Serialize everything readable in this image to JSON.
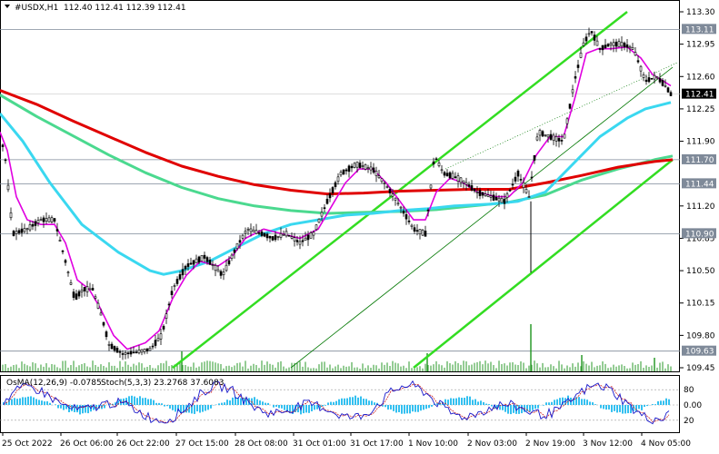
{
  "header": {
    "symbol": "#USDX,H1",
    "ohlc": "112.40 112.41 112.39 112.41"
  },
  "indicator_header": {
    "osma": "OsMA(12,26,9) -0.0785",
    "stoch": "Stoch(5,3,3) 23.2768 37.6083"
  },
  "colors": {
    "background": "#ffffff",
    "candles": "#000000",
    "ma_red": "#e00000",
    "ma_green": "#4bd98f",
    "ma_cyan": "#3ad8f0",
    "ma_magenta": "#e000e0",
    "channel": "#33dd22",
    "trend_thin": "#007700",
    "hline": "#7f8a99",
    "current_tag": "#000000",
    "level_tag": "#7f8a99",
    "osma_bars": "#33c0f0",
    "stoch_main": "#1a1acc",
    "stoch_signal": "#cc2222"
  },
  "chart_data": {
    "type": "candlestick",
    "symbol": "#USDX",
    "timeframe": "H1",
    "ylim": [
      109.45,
      113.3
    ],
    "price_ticks": [
      "113.30",
      "112.95",
      "112.60",
      "112.25",
      "111.90",
      "111.20",
      "110.85",
      "110.50",
      "110.15",
      "109.80",
      "109.45"
    ],
    "tick_values": [
      113.3,
      112.95,
      112.6,
      112.25,
      111.9,
      111.2,
      110.85,
      110.5,
      110.15,
      109.8,
      109.45
    ],
    "time_labels": [
      "25 Oct 2022",
      "26 Oct 06:00",
      "26 Oct 22:00",
      "27 Oct 15:00",
      "28 Oct 08:00",
      "31 Oct 01:00",
      "31 Oct 17:00",
      "1 Nov 10:00",
      "2 Nov 03:00",
      "2 Nov 19:00",
      "3 Nov 12:00",
      "4 Nov 05:00"
    ],
    "current_price": {
      "label": "112.41",
      "value": 112.41
    },
    "levels": [
      {
        "label": "113.11",
        "value": 113.11
      },
      {
        "label": "111.70",
        "value": 111.7
      },
      {
        "label": "111.44",
        "value": 111.44
      },
      {
        "label": "110.90",
        "value": 110.9
      },
      {
        "label": "109.63",
        "value": 109.63
      }
    ],
    "price_path": [
      [
        0,
        112.0
      ],
      [
        6,
        111.7
      ],
      [
        14,
        110.9
      ],
      [
        30,
        110.95
      ],
      [
        45,
        111.05
      ],
      [
        60,
        111.05
      ],
      [
        72,
        110.6
      ],
      [
        82,
        110.2
      ],
      [
        92,
        110.3
      ],
      [
        102,
        110.3
      ],
      [
        112,
        110.0
      ],
      [
        120,
        109.7
      ],
      [
        135,
        109.6
      ],
      [
        150,
        109.62
      ],
      [
        165,
        109.65
      ],
      [
        178,
        109.8
      ],
      [
        190,
        110.3
      ],
      [
        205,
        110.55
      ],
      [
        225,
        110.65
      ],
      [
        245,
        110.45
      ],
      [
        260,
        110.75
      ],
      [
        272,
        110.95
      ],
      [
        288,
        110.9
      ],
      [
        300,
        110.85
      ],
      [
        315,
        110.9
      ],
      [
        330,
        110.8
      ],
      [
        345,
        110.9
      ],
      [
        360,
        111.25
      ],
      [
        375,
        111.55
      ],
      [
        392,
        111.65
      ],
      [
        410,
        111.6
      ],
      [
        425,
        111.42
      ],
      [
        440,
        111.2
      ],
      [
        455,
        110.95
      ],
      [
        468,
        110.9
      ],
      [
        478,
        111.75
      ],
      [
        488,
        111.55
      ],
      [
        500,
        111.52
      ],
      [
        512,
        111.45
      ],
      [
        525,
        111.35
      ],
      [
        540,
        111.3
      ],
      [
        555,
        111.25
      ],
      [
        570,
        111.55
      ],
      [
        582,
        111.3
      ],
      [
        592,
        112.0
      ],
      [
        605,
        111.95
      ],
      [
        620,
        111.9
      ],
      [
        632,
        112.55
      ],
      [
        642,
        112.95
      ],
      [
        650,
        113.1
      ],
      [
        660,
        112.9
      ],
      [
        672,
        112.95
      ],
      [
        685,
        112.95
      ],
      [
        697,
        112.9
      ],
      [
        710,
        112.55
      ],
      [
        722,
        112.6
      ],
      [
        732,
        112.5
      ],
      [
        738,
        112.41
      ]
    ],
    "ma_red": [
      [
        0,
        112.45
      ],
      [
        40,
        112.3
      ],
      [
        80,
        112.12
      ],
      [
        120,
        111.95
      ],
      [
        160,
        111.78
      ],
      [
        200,
        111.63
      ],
      [
        240,
        111.52
      ],
      [
        280,
        111.43
      ],
      [
        320,
        111.37
      ],
      [
        360,
        111.33
      ],
      [
        400,
        111.34
      ],
      [
        440,
        111.36
      ],
      [
        480,
        111.37
      ],
      [
        520,
        111.38
      ],
      [
        560,
        111.38
      ],
      [
        600,
        111.45
      ],
      [
        640,
        111.53
      ],
      [
        680,
        111.62
      ],
      [
        720,
        111.68
      ],
      [
        740,
        111.7
      ]
    ],
    "ma_green": [
      [
        0,
        112.4
      ],
      [
        40,
        112.17
      ],
      [
        80,
        111.96
      ],
      [
        120,
        111.75
      ],
      [
        160,
        111.56
      ],
      [
        200,
        111.4
      ],
      [
        240,
        111.28
      ],
      [
        280,
        111.2
      ],
      [
        320,
        111.15
      ],
      [
        360,
        111.12
      ],
      [
        400,
        111.13
      ],
      [
        440,
        111.14
      ],
      [
        480,
        111.16
      ],
      [
        520,
        111.2
      ],
      [
        560,
        111.24
      ],
      [
        600,
        111.32
      ],
      [
        640,
        111.48
      ],
      [
        680,
        111.6
      ],
      [
        720,
        111.7
      ],
      [
        740,
        111.74
      ]
    ],
    "ma_cyan": [
      [
        0,
        112.2
      ],
      [
        25,
        111.9
      ],
      [
        55,
        111.45
      ],
      [
        90,
        111.0
      ],
      [
        130,
        110.7
      ],
      [
        165,
        110.5
      ],
      [
        180,
        110.46
      ],
      [
        200,
        110.5
      ],
      [
        230,
        110.6
      ],
      [
        260,
        110.75
      ],
      [
        290,
        110.9
      ],
      [
        320,
        111.0
      ],
      [
        350,
        111.05
      ],
      [
        380,
        111.1
      ],
      [
        410,
        111.12
      ],
      [
        440,
        111.15
      ],
      [
        470,
        111.17
      ],
      [
        500,
        111.2
      ],
      [
        540,
        111.22
      ],
      [
        570,
        111.25
      ],
      [
        600,
        111.35
      ],
      [
        630,
        111.65
      ],
      [
        660,
        111.95
      ],
      [
        690,
        112.15
      ],
      [
        710,
        112.25
      ],
      [
        738,
        112.32
      ]
    ],
    "ma_magenta": [
      [
        0,
        112.0
      ],
      [
        8,
        111.8
      ],
      [
        18,
        111.3
      ],
      [
        30,
        111.05
      ],
      [
        45,
        111.0
      ],
      [
        60,
        111.0
      ],
      [
        72,
        110.8
      ],
      [
        85,
        110.4
      ],
      [
        98,
        110.3
      ],
      [
        110,
        110.1
      ],
      [
        125,
        109.8
      ],
      [
        140,
        109.65
      ],
      [
        160,
        109.72
      ],
      [
        175,
        109.85
      ],
      [
        190,
        110.2
      ],
      [
        205,
        110.45
      ],
      [
        220,
        110.6
      ],
      [
        240,
        110.55
      ],
      [
        255,
        110.65
      ],
      [
        270,
        110.85
      ],
      [
        290,
        110.95
      ],
      [
        310,
        110.9
      ],
      [
        330,
        110.85
      ],
      [
        350,
        110.95
      ],
      [
        365,
        111.2
      ],
      [
        380,
        111.45
      ],
      [
        395,
        111.6
      ],
      [
        410,
        111.6
      ],
      [
        425,
        111.45
      ],
      [
        440,
        111.25
      ],
      [
        455,
        111.05
      ],
      [
        468,
        111.05
      ],
      [
        480,
        111.35
      ],
      [
        495,
        111.5
      ],
      [
        510,
        111.45
      ],
      [
        525,
        111.35
      ],
      [
        545,
        111.3
      ],
      [
        560,
        111.3
      ],
      [
        575,
        111.45
      ],
      [
        590,
        111.75
      ],
      [
        605,
        111.95
      ],
      [
        620,
        111.95
      ],
      [
        632,
        112.35
      ],
      [
        645,
        112.85
      ],
      [
        658,
        112.9
      ],
      [
        672,
        112.9
      ],
      [
        690,
        112.92
      ],
      [
        705,
        112.8
      ],
      [
        718,
        112.62
      ],
      [
        730,
        112.55
      ],
      [
        738,
        112.5
      ]
    ],
    "channel_upper": [
      [
        190,
        109.45
      ],
      [
        690,
        113.3
      ]
    ],
    "channel_lower": [
      [
        455,
        109.45
      ],
      [
        740,
        111.7
      ]
    ],
    "trend_thin": [
      [
        320,
        109.45
      ],
      [
        740,
        112.7
      ]
    ],
    "volume_spikes": [
      [
        584,
        52
      ],
      [
        470,
        20
      ],
      [
        200,
        22
      ],
      [
        640,
        18
      ],
      [
        720,
        15
      ]
    ],
    "indicator": {
      "stoch_levels": [
        "80",
        "0.00",
        "20"
      ],
      "stoch_level_values": [
        80,
        50,
        20
      ]
    }
  }
}
